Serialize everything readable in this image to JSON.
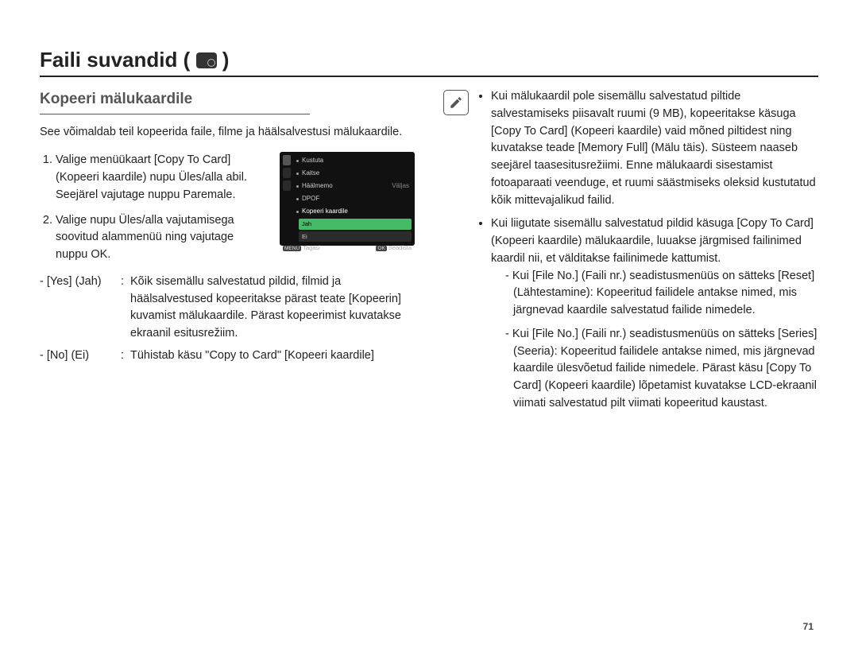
{
  "title": {
    "main": "Faili suvandid",
    "open_paren": "(",
    "close_paren": ")"
  },
  "left": {
    "subheading": "Kopeeri mälukaardile",
    "intro": "See võimaldab teil kopeerida faile, filme ja häälsalvestusi mälukaardile.",
    "steps": {
      "s1": "Valige menüükaart [Copy To Card] (Kopeeri kaardile) nupu Üles/alla abil. Seejärel vajutage nuppu Paremale.",
      "s2": "Valige nupu Üles/alla vajutamisega soovitud alammenüü ning vajutage nuppu OK."
    },
    "options": {
      "yes_label": "- [Yes] (Jah)",
      "yes_desc": "Kõik sisemällu salvestatud pildid, filmid ja häälsalvestused kopeeritakse pärast teate [Kopeerin] kuvamist mälukaardile. Pärast kopeerimist kuvatakse ekraanil esitusrežiim.",
      "no_label": "- [No] (Ei)",
      "no_desc": "Tühistab käsu \"Copy to Card\" [Kopeeri kaardile]",
      "sep": ":"
    },
    "lcd": {
      "items": {
        "i0": "Kustuta",
        "i1": "Kaitse",
        "i2": "Häälmemo",
        "i2_val": "Väljas",
        "i3": "DPOF",
        "i4": "Kopeeri kaardile"
      },
      "sub": {
        "yes": "Jah",
        "no": "Ei"
      },
      "footer": {
        "back_btn": "MENU",
        "back": "Tagasi",
        "set_btn": "OK",
        "set": "Seadista"
      }
    }
  },
  "right": {
    "bullets": {
      "b1": "Kui mälukaardil pole sisemällu salvestatud piltide salvestamiseks piisavalt ruumi (9 MB), kopeeritakse käsuga [Copy To Card] (Kopeeri kaardile) vaid mõned piltidest ning kuvatakse teade [Memory Full] (Mälu täis). Süsteem naaseb seejärel taasesitusrežiimi. Enne mälukaardi sisestamist fotoaparaati veenduge, et ruumi säästmiseks oleksid kustutatud kõik mittevajalikud failid.",
      "b2": "Kui liigutate sisemällu salvestatud pildid käsuga [Copy To Card] (Kopeeri kaardile) mälukaardile, luuakse järgmised failinimed kaardil nii, et välditakse failinimede kattumist.",
      "b2a": "Kui [File No.] (Faili nr.) seadistusmenüüs on sätteks [Reset] (Lähtestamine): Kopeeritud failidele antakse nimed, mis järgnevad kaardile salvestatud failide nimedele.",
      "b2b": "Kui [File No.] (Faili nr.) seadistusmenüüs on sätteks [Series] (Seeria): Kopeeritud failidele antakse nimed, mis järgnevad kaardile ülesvõetud failide nimedele. Pärast käsu [Copy To Card] (Kopeeri kaardile) lõpetamist kuvatakse LCD-ekraanil viimati salvestatud pilt viimati kopeeritud kaustast."
    }
  },
  "page_number": "71"
}
